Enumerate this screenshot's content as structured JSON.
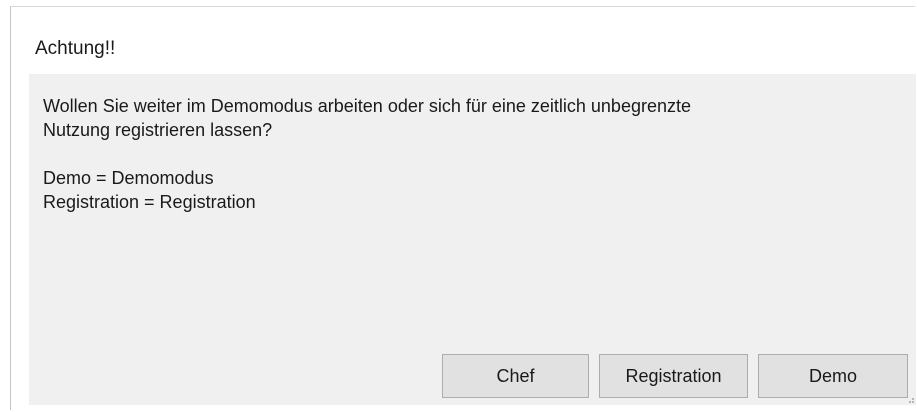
{
  "dialog": {
    "title": "Achtung!!",
    "message": {
      "line1": "Wollen Sie weiter im Demomodus arbeiten oder sich für eine zeitlich unbegrenzte",
      "line2": "Nutzung registrieren lassen?",
      "line3": "Demo = Demomodus",
      "line4": "Registration = Registration"
    },
    "buttons": {
      "chef": "Chef",
      "registration": "Registration",
      "demo": "Demo"
    }
  },
  "colors": {
    "background": "#ffffff",
    "panel": "#f0f0f0",
    "button": "#e1e1e1",
    "button_border": "#adadad"
  }
}
